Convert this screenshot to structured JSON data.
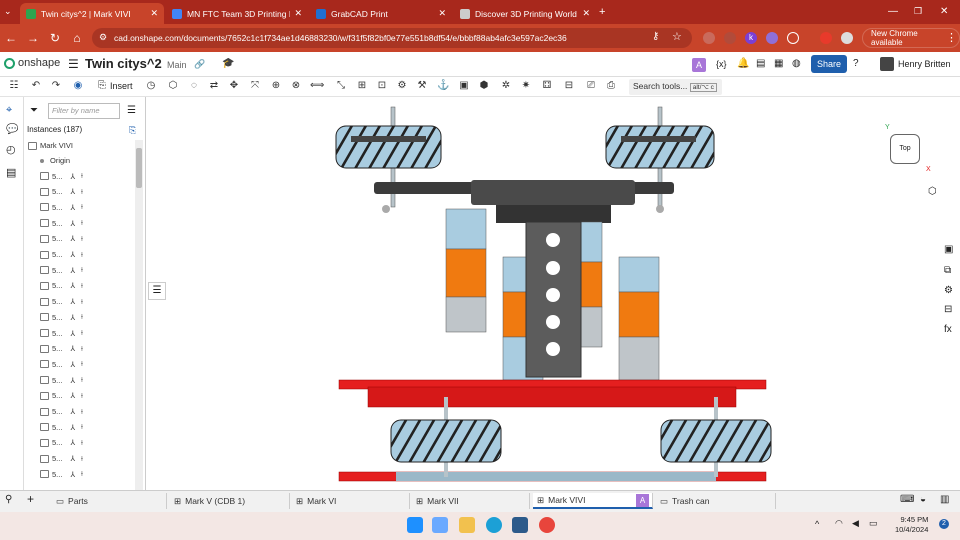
{
  "browser": {
    "tabs": [
      {
        "title": "Twin citys^2 | Mark VIVI",
        "color": "#2ea44f",
        "active": true
      },
      {
        "title": "MN FTC Team 3D Printing Requ",
        "color": "#4285f4",
        "active": false
      },
      {
        "title": "GrabCAD Print",
        "color": "#1f6fd1",
        "active": false
      },
      {
        "title": "Discover 3D Printing World - Te",
        "color": "#cccccc",
        "active": false
      }
    ],
    "new_tab": "+",
    "url": "cad.onshape.com/documents/7652c1c1f734ae1d46883230/w/f31f5f82bf0e77e551b8df54/e/bbbf88ab4afc3e597ac2ec36",
    "chrome_available": "New Chrome available",
    "profile_initial": "k"
  },
  "onshape": {
    "logo_text": "onshape",
    "doc_name": "Twin citys^2",
    "branch": "Main",
    "avatar_initial": "A",
    "share_label": "Share",
    "user_name": "Henry Britten",
    "insert_label": "Insert",
    "search_tools": "Search tools...",
    "search_shortcut": "alt/⌥ c"
  },
  "feature_list": {
    "filter_placeholder": "Filter by name",
    "instances_label": "Instances (187)",
    "root": "Mark VIVI",
    "origin": "Origin",
    "item_label": "5..."
  },
  "viewcube": {
    "face": "Top",
    "axis_y": "Y",
    "axis_x": "X"
  },
  "bottom_tabs": [
    {
      "label": "Parts",
      "type": "folder"
    },
    {
      "label": "Mark V (CDB 1)",
      "type": "assembly"
    },
    {
      "label": "Mark VI",
      "type": "assembly"
    },
    {
      "label": "Mark VII",
      "type": "assembly"
    },
    {
      "label": "Mark VIVI",
      "type": "assembly",
      "active": true
    },
    {
      "label": "Trash can",
      "type": "folder"
    }
  ],
  "bottom_tab_avatar": "A",
  "taskbar": {
    "time": "9:45 PM",
    "date": "10/4/2024",
    "notif_count": "2"
  },
  "colors": {
    "chrome_red": "#c8442a",
    "accent_blue": "#1f5fad",
    "plate_red": "#e51f1f",
    "wheel_blue": "#a9cce0",
    "motor_orange": "#f07a10"
  }
}
